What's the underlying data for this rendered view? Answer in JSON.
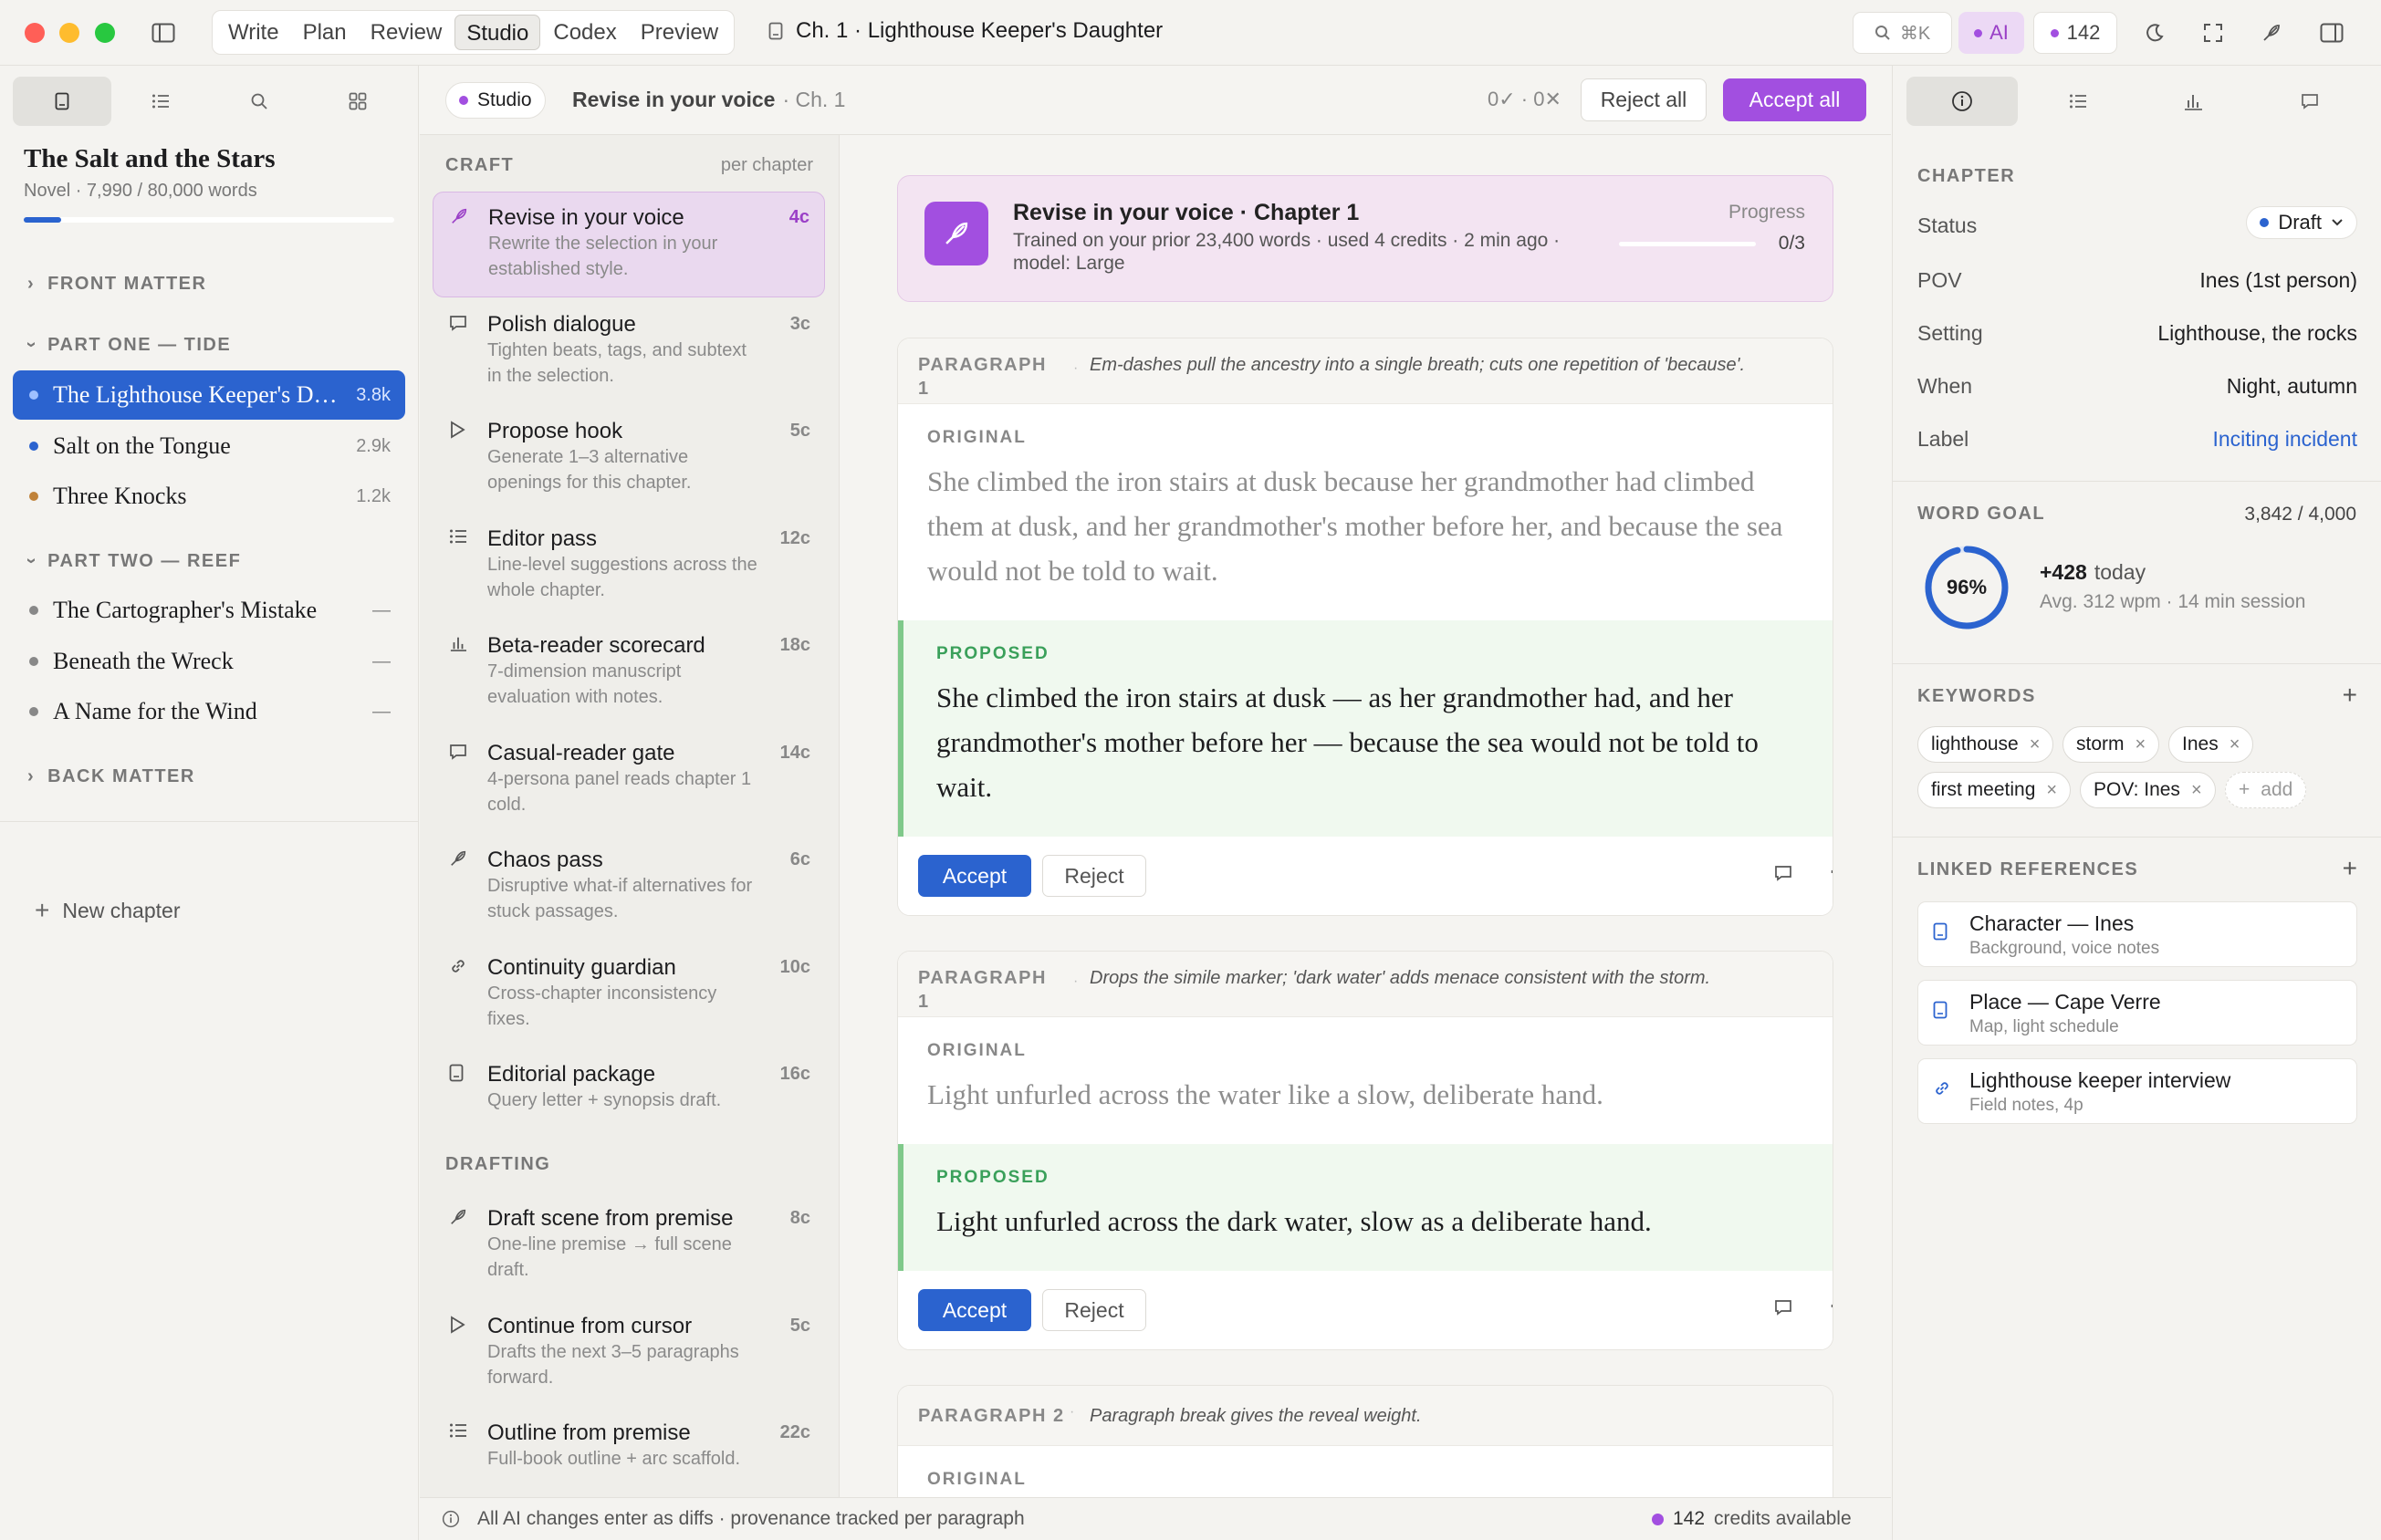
{
  "titlebar": {
    "modes": [
      "Write",
      "Plan",
      "Review",
      "Studio",
      "Codex",
      "Preview"
    ],
    "active_mode": "Studio",
    "doc_title": "Ch. 1 · Lighthouse Keeper's Daughter",
    "search_shortcut": "⌘K",
    "ai_label": "AI",
    "credits": "142"
  },
  "sidebar": {
    "project_title": "The Salt and the Stars",
    "project_meta": "Novel · 7,990 / 80,000 words",
    "progress": 0.1,
    "sections": {
      "front": "FRONT MATTER",
      "part_one": "PART ONE — TIDE",
      "part_two": "PART TWO — REEF",
      "back": "BACK MATTER"
    },
    "part_one_chapters": [
      {
        "name": "The Lighthouse Keeper's Daughter",
        "words": "3.8k",
        "color": "#2b63cf"
      },
      {
        "name": "Salt on the Tongue",
        "words": "2.9k",
        "color": "#2b63cf"
      },
      {
        "name": "Three Knocks",
        "words": "1.2k",
        "color": "#c0823a"
      }
    ],
    "part_two_chapters": [
      {
        "name": "The Cartographer's Mistake",
        "words": "—",
        "color": "#888888"
      },
      {
        "name": "Beneath the Wreck",
        "words": "—",
        "color": "#888888"
      },
      {
        "name": "A Name for the Wind",
        "words": "—",
        "color": "#888888"
      }
    ],
    "new_chapter": "New chapter"
  },
  "toolbar": {
    "badge": "Studio",
    "title": "Revise in your voice",
    "subtitle": "· Ch. 1",
    "counts": "0✓ · 0✕",
    "reject_all": "Reject all",
    "accept_all": "Accept all"
  },
  "craft": {
    "craft_head": "CRAFT",
    "craft_note": "per chapter",
    "drafting_head": "DRAFTING",
    "craft_tools": [
      {
        "name": "Revise in your voice",
        "desc": "Rewrite the selection in your established style.",
        "cost": "4c",
        "icon": "feather-icon"
      },
      {
        "name": "Polish dialogue",
        "desc": "Tighten beats, tags, and subtext in the selection.",
        "cost": "3c",
        "icon": "speech-bubble-icon"
      },
      {
        "name": "Propose hook",
        "desc": "Generate 1–3 alternative openings for this chapter.",
        "cost": "5c",
        "icon": "play-icon"
      },
      {
        "name": "Editor pass",
        "desc": "Line-level suggestions across the whole chapter.",
        "cost": "12c",
        "icon": "list-icon"
      },
      {
        "name": "Beta-reader scorecard",
        "desc": "7-dimension manuscript evaluation with notes.",
        "cost": "18c",
        "icon": "bar-chart-icon"
      },
      {
        "name": "Casual-reader gate",
        "desc": "4-persona panel reads chapter 1 cold.",
        "cost": "14c",
        "icon": "speech-bubble-icon"
      },
      {
        "name": "Chaos pass",
        "desc": "Disruptive what-if alternatives for stuck passages.",
        "cost": "6c",
        "icon": "feather-icon"
      },
      {
        "name": "Continuity guardian",
        "desc": "Cross-chapter inconsistency fixes.",
        "cost": "10c",
        "icon": "link-icon"
      },
      {
        "name": "Editorial package",
        "desc": "Query letter + synopsis draft.",
        "cost": "16c",
        "icon": "document-icon"
      }
    ],
    "drafting_tools": [
      {
        "name": "Draft scene from premise",
        "desc": "One-line premise → full scene draft.",
        "cost": "8c",
        "icon": "feather-icon"
      },
      {
        "name": "Continue from cursor",
        "desc": "Drafts the next 3–5 paragraphs forward.",
        "cost": "5c",
        "icon": "play-icon"
      },
      {
        "name": "Outline from premise",
        "desc": "Full-book outline + arc scaffold.",
        "cost": "22c",
        "icon": "list-icon"
      }
    ]
  },
  "banner": {
    "title": "Revise in your voice · Chapter 1",
    "meta": "Trained on your prior 23,400 words · used 4 credits · 2 min ago · model: Large",
    "progress_label": "Progress",
    "progress_value": "0/3",
    "progress": 0
  },
  "paragraphs": [
    {
      "label": "PARAGRAPH 1",
      "note": "Em-dashes pull the ancestry into a single breath; cuts one repetition of 'because'.",
      "original_label": "ORIGINAL",
      "original": "She climbed the iron stairs at dusk because her grandmother had climbed them at dusk, and her grandmother's mother before her, and because the sea would not be told to wait.",
      "proposed_label": "PROPOSED",
      "proposed": "She climbed the iron stairs at dusk — as her grandmother had, and her grandmother's mother before her — because the sea would not be told to wait.",
      "accept": "Accept",
      "reject": "Reject"
    },
    {
      "label": "PARAGRAPH 1",
      "note": "Drops the simile marker; 'dark water' adds menace consistent with the storm.",
      "original_label": "ORIGINAL",
      "original": "Light unfurled across the water like a slow, deliberate hand.",
      "proposed_label": "PROPOSED",
      "proposed": "Light unfurled across the dark water, slow as a deliberate hand.",
      "accept": "Accept",
      "reject": "Reject"
    },
    {
      "label": "PARAGRAPH 2",
      "note": "Paragraph break gives the reveal weight.",
      "original_label": "ORIGINAL"
    }
  ],
  "right": {
    "chapter_head": "CHAPTER",
    "status_key": "Status",
    "status_value": "Draft",
    "pov_key": "POV",
    "pov_value": "Ines (1st person)",
    "setting_key": "Setting",
    "setting_value": "Lighthouse, the rocks",
    "when_key": "When",
    "when_value": "Night, autumn",
    "label_key": "Label",
    "label_value": "Inciting incident",
    "goal_head": "WORD GOAL",
    "goal_value": "3,842 / 4,000",
    "goal_pct": "96%",
    "goal_fraction": 0.96,
    "today_value": "+428",
    "today_label": "today",
    "session": "Avg. 312 wpm · 14 min session",
    "keywords_head": "KEYWORDS",
    "keywords": [
      "lighthouse",
      "storm",
      "Ines",
      "first meeting",
      "POV: Ines"
    ],
    "add_keyword": "add",
    "refs_head": "LINKED REFERENCES",
    "refs": [
      {
        "title": "Character — Ines",
        "sub": "Background, voice notes",
        "icon": "document-icon"
      },
      {
        "title": "Place — Cape Verre",
        "sub": "Map, light schedule",
        "icon": "document-icon"
      },
      {
        "title": "Lighthouse keeper interview",
        "sub": "Field notes, 4p",
        "icon": "link-icon"
      }
    ]
  },
  "status": {
    "left": "All AI changes enter as diffs · provenance tracked per paragraph",
    "credits": "142",
    "credits_label": "credits available"
  },
  "colors": {
    "accent": "#2b63cf",
    "ai_purple": "#a24fe0",
    "proposed_green": "#7fc98a"
  }
}
